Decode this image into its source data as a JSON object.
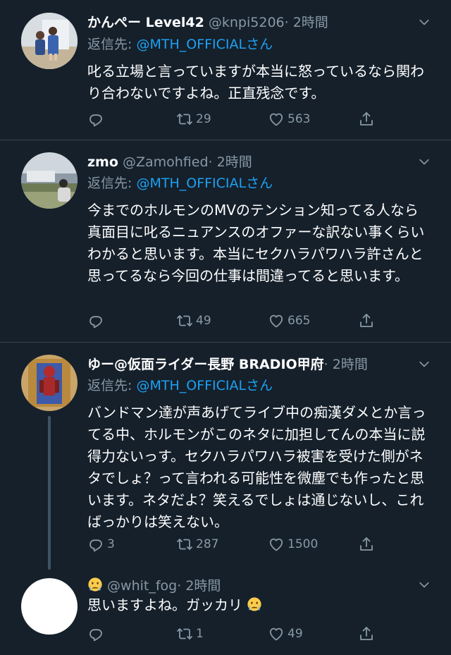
{
  "tweets": [
    {
      "name": "かんぺー Level42",
      "handle": "@knpi5206",
      "time": "· 2時間",
      "reply_prefix": "返信先: ",
      "reply_mention": "@MTH_OFFICIAL",
      "reply_suffix": "さん",
      "text": "叱る立場と言っていますが本当に怒っているなら関わり合わないですよね。正直残念です。",
      "reply_count": "",
      "retweet_count": "29",
      "like_count": "563"
    },
    {
      "name": "zmo",
      "handle": "@Zamohfied",
      "time": "· 2時間",
      "reply_prefix": "返信先: ",
      "reply_mention": "@MTH_OFFICIAL",
      "reply_suffix": "さん",
      "text": "今までのホルモンのMVのテンション知ってる人なら真面目に叱るニュアンスのオファーな訳ない事くらいわかると思います。本当にセクハラパワハラ許さんと思ってるなら今回の仕事は間違ってると思います。",
      "reply_count": "",
      "retweet_count": "49",
      "like_count": "665"
    },
    {
      "name": "ゆー@仮面ライダー長野 BRADIO甲府",
      "handle": "",
      "time": "· 2時間",
      "reply_prefix": "返信先: ",
      "reply_mention": "@MTH_OFFICIAL",
      "reply_suffix": "さん",
      "text": "バンドマン達が声あげてライブ中の痴漢ダメとか言ってる中、ホルモンがこのネタに加担してんの本当に説得力ないっす。セクハラパワハラ被害を受けた側がネタでしょ？って言われる可能性を微塵でも作ったと思います。ネタだよ？笑えるでしょは通じないし、こればっかりは笑えない。",
      "reply_count": "3",
      "retweet_count": "287",
      "like_count": "1500"
    },
    {
      "name": "",
      "handle": "@whit_fog",
      "time": "· 2時間",
      "text": "思いますよね。ガッカリ",
      "reply_count": "",
      "retweet_count": "1",
      "like_count": "49"
    }
  ],
  "colors": {
    "background": "#15202b",
    "divider": "#38444d",
    "secondary_text": "#8899a6",
    "link": "#1da1f2"
  },
  "icons": [
    "reply-icon",
    "retweet-icon",
    "like-icon",
    "share-icon",
    "caret-down-icon",
    "crying-face-emoji"
  ]
}
